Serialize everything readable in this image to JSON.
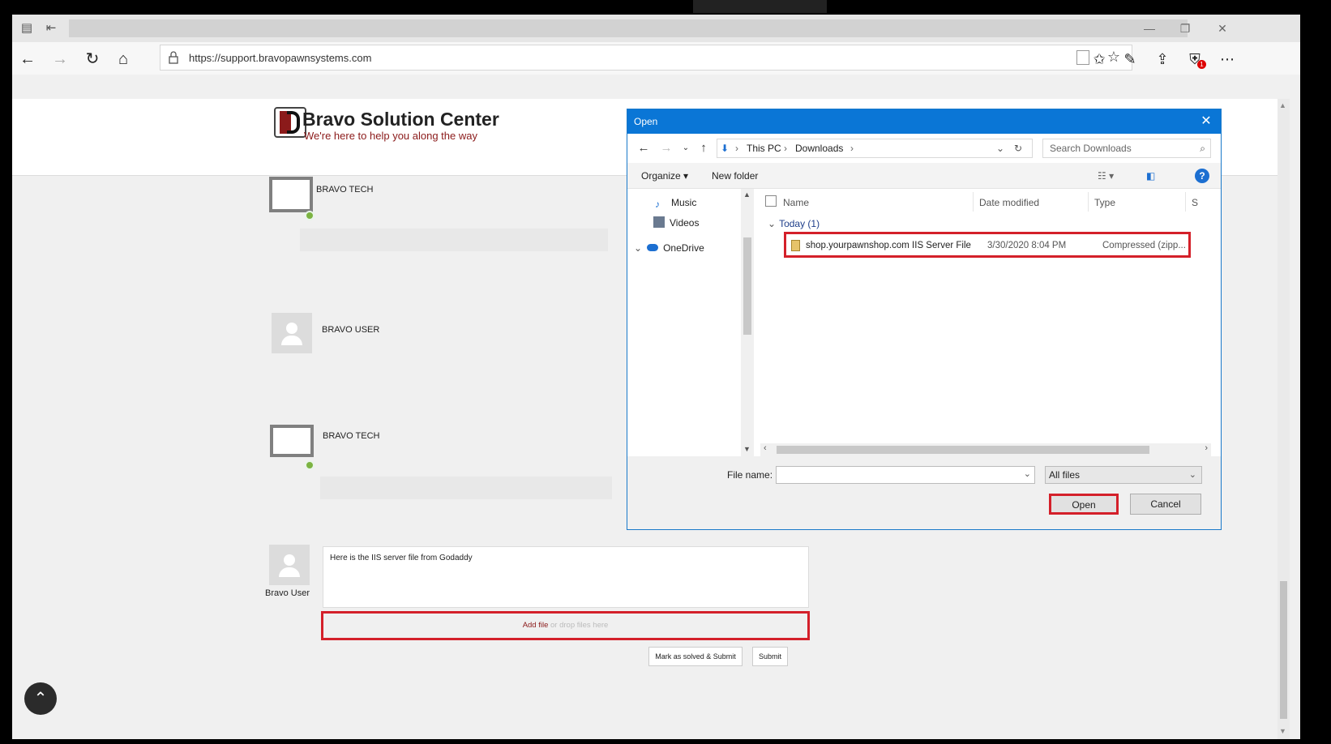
{
  "browser": {
    "url": "https://support.bravopawnsystems.com",
    "notification_count": "1"
  },
  "site": {
    "brand": "Bravo Solution Center",
    "tagline": "We're here to help you along the way",
    "posts": [
      {
        "author": "BRAVO TECH"
      },
      {
        "author": "BRAVO USER"
      },
      {
        "author": "BRAVO TECH"
      }
    ],
    "reply": {
      "author": "Bravo User",
      "text": "Here is the IIS server file from Godaddy",
      "add_file": "Add file",
      "drop_hint": "or drop files here",
      "mark_solved": "Mark as solved & Submit",
      "submit": "Submit"
    }
  },
  "dialog": {
    "title": "Open",
    "breadcrumb": [
      "This PC",
      "Downloads"
    ],
    "search_placeholder": "Search Downloads",
    "organize": "Organize",
    "new_folder": "New folder",
    "nav_items": [
      "Music",
      "Videos",
      "OneDrive"
    ],
    "columns": [
      "Name",
      "Date modified",
      "Type",
      "S"
    ],
    "group": "Today (1)",
    "files": [
      {
        "name": "shop.yourpawnshop.com IIS Server File",
        "date": "3/30/2020 8:04 PM",
        "type": "Compressed (zipp..."
      }
    ],
    "file_name_label": "File name:",
    "file_name_value": "",
    "file_type": "All files",
    "open": "Open",
    "cancel": "Cancel"
  },
  "colors": {
    "highlight": "#d4202a",
    "dialog_title": "#0a76d6",
    "brand_red": "#8b1a1a"
  }
}
